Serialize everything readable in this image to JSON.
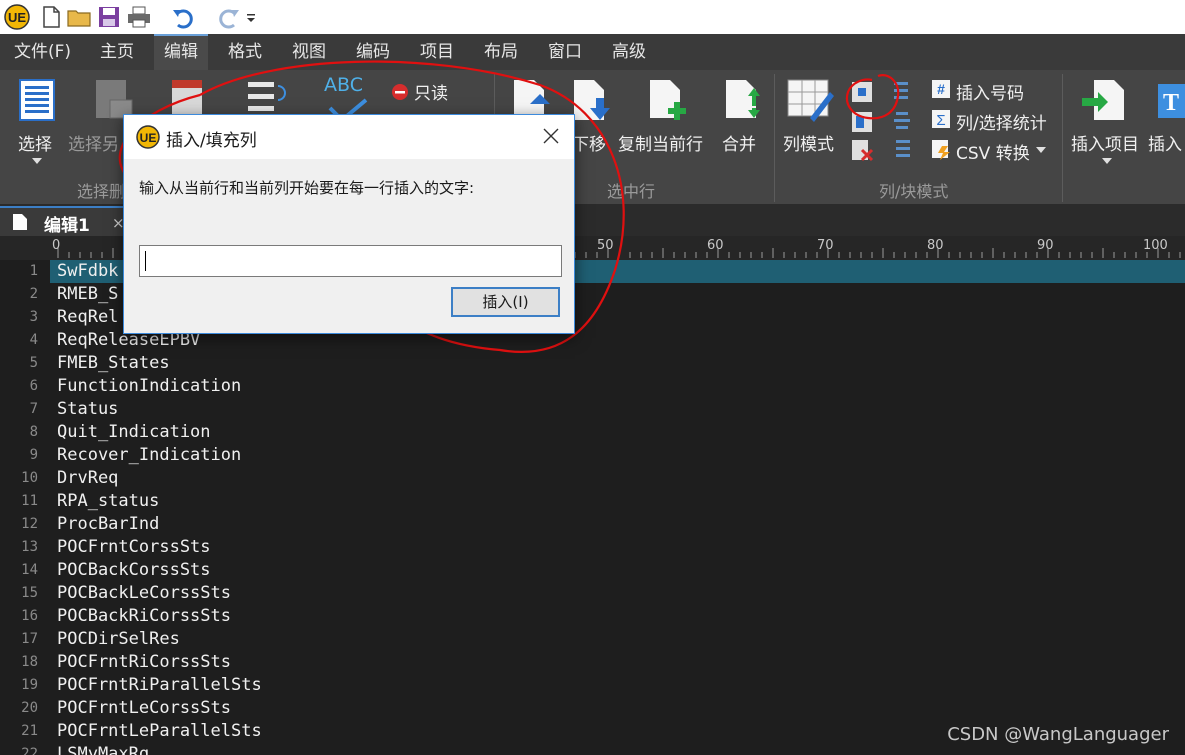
{
  "menu": {
    "items": [
      "文件(F)",
      "主页",
      "编辑",
      "格式",
      "视图",
      "编码",
      "项目",
      "布局",
      "窗口",
      "高级"
    ],
    "active_index": 2
  },
  "ribbon": {
    "select": "选择",
    "select_other": "选择另",
    "readonly": "只读",
    "move_down": "下移",
    "copy_line": "复制当前行",
    "merge": "合并",
    "column_mode": "列模式",
    "insert_number": "插入号码",
    "col_stats": "列/选择统计",
    "csv_convert": "CSV 转换",
    "insert_item": "插入项目",
    "insert_more": "插入",
    "abc": "ABC",
    "groups": {
      "select": "选择删",
      "selected_line": "选中行",
      "column_block": "列/块模式"
    }
  },
  "tab": {
    "label": "编辑1"
  },
  "ruler": [
    "0",
    "50",
    "60",
    "70",
    "80",
    "90",
    "100"
  ],
  "editor": {
    "lines": [
      {
        "n": "1",
        "text": "SwFdbk"
      },
      {
        "n": "2",
        "text": "RMEB_S"
      },
      {
        "n": "3",
        "text": "ReqRel"
      },
      {
        "n": "4",
        "text": "ReqReleaseEPBV"
      },
      {
        "n": "5",
        "text": "FMEB_States"
      },
      {
        "n": "6",
        "text": "FunctionIndication"
      },
      {
        "n": "7",
        "text": "Status"
      },
      {
        "n": "8",
        "text": "Quit_Indication"
      },
      {
        "n": "9",
        "text": "Recover_Indication"
      },
      {
        "n": "10",
        "text": "DrvReq"
      },
      {
        "n": "11",
        "text": "RPA_status"
      },
      {
        "n": "12",
        "text": "ProcBarInd"
      },
      {
        "n": "13",
        "text": "POCFrntCorssSts"
      },
      {
        "n": "14",
        "text": "POCBackCorssSts"
      },
      {
        "n": "15",
        "text": "POCBackLeCorssSts"
      },
      {
        "n": "16",
        "text": "POCBackRiCorssSts"
      },
      {
        "n": "17",
        "text": "POCDirSelRes"
      },
      {
        "n": "18",
        "text": "POCFrntRiCorssSts"
      },
      {
        "n": "19",
        "text": "POCFrntRiParallelSts"
      },
      {
        "n": "20",
        "text": "POCFrntLeCorssSts"
      },
      {
        "n": "21",
        "text": "POCFrntLeParallelSts"
      },
      {
        "n": "22",
        "text": "LSMyMaxRq"
      }
    ]
  },
  "dialog": {
    "title": "插入/填充列",
    "prompt": "输入从当前行和当前列开始要在每一行插入的文字:",
    "input_value": "",
    "insert_button": "插入(I)"
  },
  "watermark": "CSDN @WangLanguager",
  "colors": {
    "accent": "#3c7fc6",
    "current_line": "#1f5f73",
    "annotation": "#e01010"
  }
}
